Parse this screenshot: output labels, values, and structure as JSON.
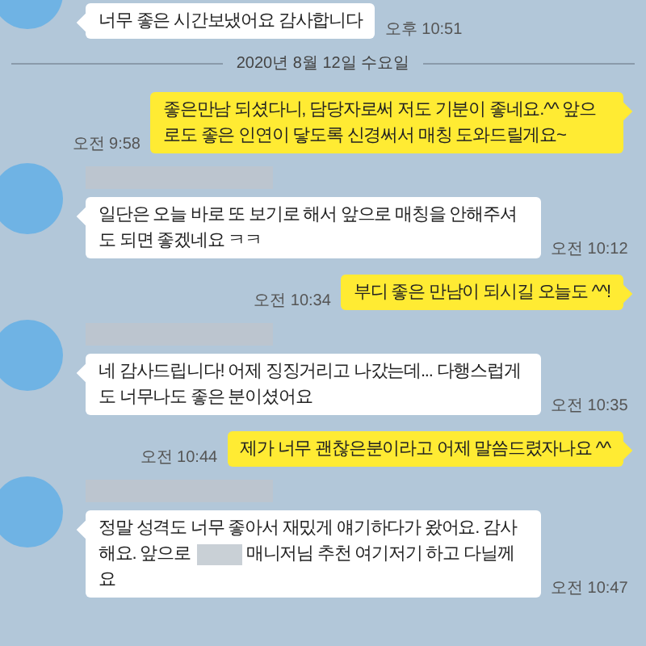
{
  "messages": [
    {
      "kind": "incoming",
      "segments": [
        {
          "kind": "text",
          "text": "너무 좋은 시간보냈어요 감사합니다"
        }
      ],
      "time": "오후 10:51"
    },
    {
      "kind": "date",
      "text": "2020년 8월 12일 수요일"
    },
    {
      "kind": "outgoing",
      "segments": [
        {
          "kind": "text",
          "text": "좋은만남 되셨다니, 담당자로써 저도 기분이 좋네요.^^ 앞으로도 좋은 인연이 닿도록 신경써서 매칭 도와드릴게요~"
        }
      ],
      "time": "오전 9:58"
    },
    {
      "kind": "incoming",
      "segments": [
        {
          "kind": "text",
          "text": "일단은 오늘 바로 또 보기로 해서 앞으로 매칭을 안해주셔도 되면 좋겠네요 ㅋㅋ"
        }
      ],
      "time": "오전 10:12"
    },
    {
      "kind": "outgoing",
      "segments": [
        {
          "kind": "text",
          "text": "부디 좋은 만남이 되시길 오늘도 ^^!"
        }
      ],
      "time": "오전 10:34"
    },
    {
      "kind": "incoming",
      "segments": [
        {
          "kind": "text",
          "text": "네 감사드립니다! 어제 징징거리고 나갔는데... 다행스럽게도 너무나도 좋은 분이셨어요"
        }
      ],
      "time": "오전 10:35"
    },
    {
      "kind": "outgoing",
      "segments": [
        {
          "kind": "text",
          "text": "제가 너무 괜찮은분이라고 어제 말씀드렸자나요 ^^"
        }
      ],
      "time": "오전 10:44"
    },
    {
      "kind": "incoming",
      "segments": [
        {
          "kind": "text",
          "text": "정말 성격도 너무 좋아서 재밌게 얘기하다가 왔어요. 감사해요. 앞으로 "
        },
        {
          "kind": "redacted"
        },
        {
          "kind": "text",
          "text": "매니저님 추천 여기저기 하고 다닐께요"
        }
      ],
      "time": "오전 10:47"
    }
  ]
}
